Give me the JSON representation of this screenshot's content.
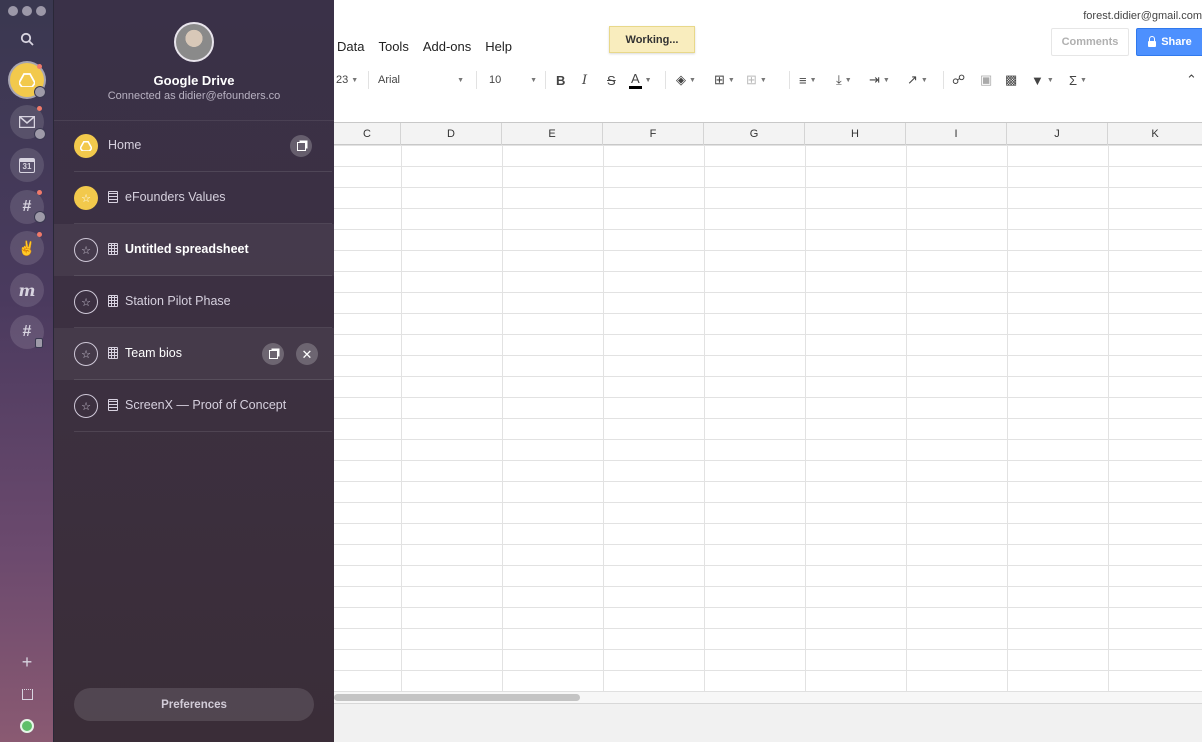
{
  "drive": {
    "title": "Google Drive",
    "connected": "Connected as didier@efounders.co",
    "items": [
      {
        "label": "Home",
        "icon": "drive-icon",
        "kind": "home"
      },
      {
        "label": "eFounders Values",
        "icon": "star-icon",
        "kind": "doc",
        "starred": true
      },
      {
        "label": "Untitled spreadsheet",
        "icon": "star-icon",
        "kind": "sheet",
        "active": true
      },
      {
        "label": "Station Pilot Phase",
        "icon": "star-icon",
        "kind": "sheet"
      },
      {
        "label": "Team bios",
        "icon": "star-icon",
        "kind": "sheet",
        "hovered": true
      },
      {
        "label": "ScreenX — Proof of Concept",
        "icon": "star-icon",
        "kind": "doc"
      }
    ],
    "preferences": "Preferences"
  },
  "rail": {
    "apps": [
      "google-drive-icon",
      "gmail-icon",
      "calendar-icon",
      "slack-icon",
      "rock-hand-icon",
      "m-app-icon",
      "slack-icon"
    ],
    "calendar_day": "31",
    "bottom": [
      "add-icon",
      "window-icon",
      "status-icon"
    ]
  },
  "sheet": {
    "account": "forest.didier@gmail.com",
    "menu": [
      "Data",
      "Tools",
      "Add-ons",
      "Help"
    ],
    "status": "Working...",
    "comments": "Comments",
    "share": "Share",
    "toolbar": {
      "number_format": "23",
      "font": "Arial",
      "font_size": "10"
    },
    "columns": [
      "C",
      "D",
      "E",
      "F",
      "G",
      "H",
      "I",
      "J",
      "K"
    ]
  },
  "colors": {
    "accent": "#f2c94c",
    "share_blue": "#4d90fe",
    "working_bg": "#f9edbe"
  }
}
